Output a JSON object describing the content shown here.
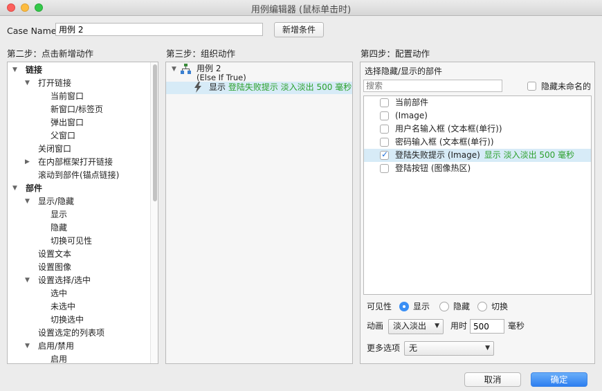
{
  "window": {
    "title": "用例编辑器 (鼠标单击时)"
  },
  "case": {
    "label": "Case Name",
    "value": "用例 2",
    "add_condition_label": "新增条件"
  },
  "step2": {
    "title": "第二步：点击新增动作",
    "tree": [
      {
        "label": "链接",
        "expanded": true
      },
      {
        "label": "打开链接",
        "expanded": true
      },
      {
        "label": "当前窗口"
      },
      {
        "label": "新窗口/标签页"
      },
      {
        "label": "弹出窗口"
      },
      {
        "label": "父窗口"
      },
      {
        "label": "关闭窗口"
      },
      {
        "label": "在内部框架打开链接",
        "expanded": false
      },
      {
        "label": "滚动到部件(锚点链接)"
      },
      {
        "label": "部件",
        "expanded": true
      },
      {
        "label": "显示/隐藏",
        "expanded": true
      },
      {
        "label": "显示"
      },
      {
        "label": "隐藏"
      },
      {
        "label": "切换可见性"
      },
      {
        "label": "设置文本"
      },
      {
        "label": "设置图像"
      },
      {
        "label": "设置选择/选中",
        "expanded": true
      },
      {
        "label": "选中"
      },
      {
        "label": "未选中"
      },
      {
        "label": "切换选中"
      },
      {
        "label": "设置选定的列表项"
      },
      {
        "label": "启用/禁用",
        "expanded": true
      },
      {
        "label": "启用"
      }
    ]
  },
  "step3": {
    "title": "第三步：组织动作",
    "case_name": "用例 2",
    "condition": "(Else If True)",
    "action_verb": "显示",
    "action_detail": "登陆失败提示 淡入淡出 500 毫秒"
  },
  "step4": {
    "title": "第四步：配置动作",
    "subtitle": "选择隐藏/显示的部件",
    "search_placeholder": "搜索",
    "hide_unnamed_label": "隐藏未命名的",
    "widgets": [
      {
        "label": "当前部件",
        "checked": false,
        "detail": ""
      },
      {
        "label": "(Image)",
        "checked": false,
        "detail": ""
      },
      {
        "label": "用户名输入框 (文本框(单行))",
        "checked": false,
        "detail": ""
      },
      {
        "label": "密码输入框 (文本框(单行))",
        "checked": false,
        "detail": ""
      },
      {
        "label": "登陆失败提示 (Image)",
        "checked": true,
        "detail": "显示 淡入淡出 500 毫秒"
      },
      {
        "label": "登陆按钮 (图像热区)",
        "checked": false,
        "detail": ""
      }
    ],
    "visibility_label": "可见性",
    "visibility_options": [
      "显示",
      "隐藏",
      "切换"
    ],
    "visibility_selected": "显示",
    "animation_label": "动画",
    "animation_value": "淡入淡出",
    "duration_label": "用时",
    "duration_value": "500",
    "duration_unit": "毫秒",
    "more_options_label": "更多选项",
    "more_options_value": "无"
  },
  "footer": {
    "cancel_label": "取消",
    "ok_label": "确定"
  },
  "colors": {
    "accent": "#3a8ff5",
    "selection": "#d7ebf7",
    "action_green": "#2ba02b"
  }
}
